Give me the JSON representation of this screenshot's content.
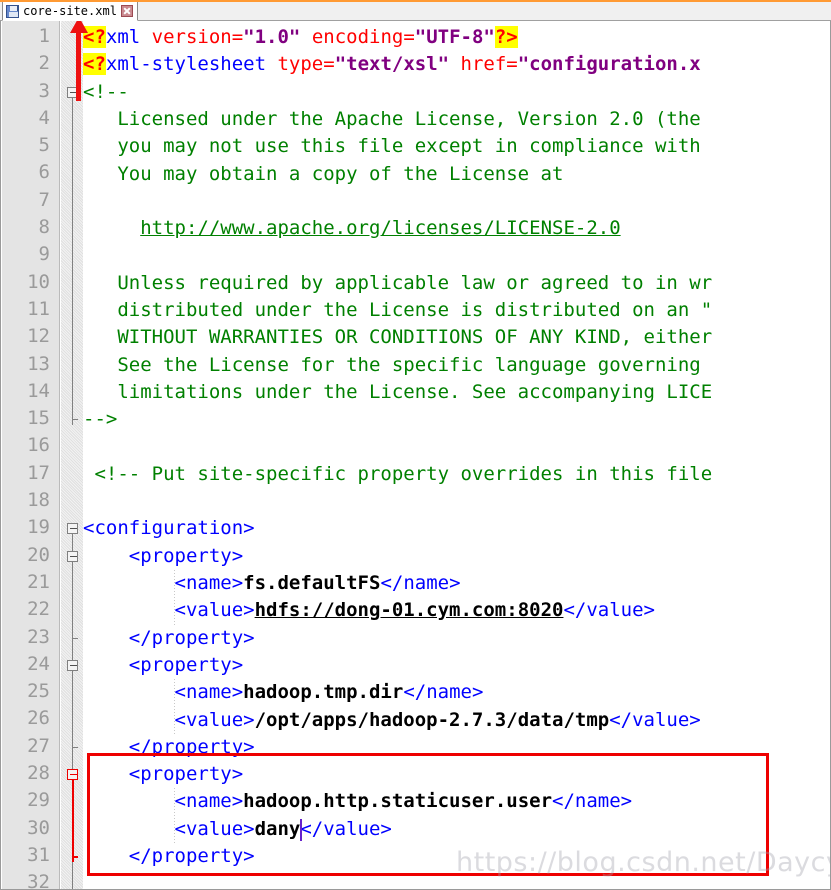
{
  "window": {
    "title": "core-site.xml",
    "accent_top_color": "#ff9a33"
  },
  "tab": {
    "label": "core-site.xml",
    "save_icon": "floppy-disk-icon",
    "close_icon": "close-icon"
  },
  "editor": {
    "language": "xml",
    "total_lines_visible": 32,
    "cursor": {
      "line": 30,
      "after_text": "dany"
    },
    "current_line": 30,
    "line_numbers": [
      "1",
      "2",
      "3",
      "4",
      "5",
      "6",
      "7",
      "8",
      "9",
      "10",
      "11",
      "12",
      "13",
      "14",
      "15",
      "16",
      "17",
      "18",
      "19",
      "20",
      "21",
      "22",
      "23",
      "24",
      "25",
      "26",
      "27",
      "28",
      "29",
      "30",
      "31",
      "32"
    ],
    "lines": [
      {
        "n": 1,
        "segments": [
          {
            "cls": "t-pi",
            "text": "<?"
          },
          {
            "cls": "t-tag",
            "text": "xml "
          },
          {
            "cls": "t-attr",
            "text": "version="
          },
          {
            "cls": "t-str",
            "text": "\"1.0\""
          },
          {
            "cls": "t-attr",
            "text": " encoding="
          },
          {
            "cls": "t-str",
            "text": "\"UTF-8\""
          },
          {
            "cls": "t-pi",
            "text": "?>"
          }
        ]
      },
      {
        "n": 2,
        "segments": [
          {
            "cls": "t-pi",
            "text": "<?"
          },
          {
            "cls": "t-tag",
            "text": "xml-stylesheet "
          },
          {
            "cls": "t-attr",
            "text": "type="
          },
          {
            "cls": "t-str",
            "text": "\"text/xsl\""
          },
          {
            "cls": "t-attr",
            "text": " href="
          },
          {
            "cls": "t-str",
            "text": "\"configuration.x"
          }
        ]
      },
      {
        "n": 3,
        "segments": [
          {
            "cls": "t-comment",
            "text": "<!--"
          }
        ]
      },
      {
        "n": 4,
        "segments": [
          {
            "cls": "t-comment",
            "text": "   Licensed under the Apache License, Version 2.0 (the"
          }
        ]
      },
      {
        "n": 5,
        "segments": [
          {
            "cls": "t-comment",
            "text": "   you may not use this file except in compliance with"
          }
        ]
      },
      {
        "n": 6,
        "segments": [
          {
            "cls": "t-comment",
            "text": "   You may obtain a copy of the License at"
          }
        ]
      },
      {
        "n": 7,
        "segments": [
          {
            "cls": "t-comment",
            "text": ""
          }
        ]
      },
      {
        "n": 8,
        "segments": [
          {
            "cls": "t-comment",
            "text": "     "
          },
          {
            "cls": "t-url",
            "text": "http://www.apache.org/licenses/LICENSE-2.0"
          }
        ]
      },
      {
        "n": 9,
        "segments": [
          {
            "cls": "t-comment",
            "text": ""
          }
        ]
      },
      {
        "n": 10,
        "segments": [
          {
            "cls": "t-comment",
            "text": "   Unless required by applicable law or agreed to in wr"
          }
        ]
      },
      {
        "n": 11,
        "segments": [
          {
            "cls": "t-comment",
            "text": "   distributed under the License is distributed on an \""
          }
        ]
      },
      {
        "n": 12,
        "segments": [
          {
            "cls": "t-comment",
            "text": "   WITHOUT WARRANTIES OR CONDITIONS OF ANY KIND, either"
          }
        ]
      },
      {
        "n": 13,
        "segments": [
          {
            "cls": "t-comment",
            "text": "   See the License for the specific language governing "
          }
        ]
      },
      {
        "n": 14,
        "segments": [
          {
            "cls": "t-comment",
            "text": "   limitations under the License. See accompanying LICE"
          }
        ]
      },
      {
        "n": 15,
        "segments": [
          {
            "cls": "t-comment",
            "text": "-->"
          }
        ]
      },
      {
        "n": 16,
        "segments": [
          {
            "cls": "t-comment",
            "text": ""
          }
        ]
      },
      {
        "n": 17,
        "segments": [
          {
            "cls": "t-comment",
            "text": " <!-- Put site-specific property overrides in this file"
          }
        ]
      },
      {
        "n": 18,
        "segments": [
          {
            "cls": "t-comment",
            "text": ""
          }
        ]
      },
      {
        "n": 19,
        "segments": [
          {
            "cls": "t-tag",
            "text": "<configuration>"
          }
        ]
      },
      {
        "n": 20,
        "segments": [
          {
            "cls": "t-tag",
            "text": "    <property>"
          }
        ]
      },
      {
        "n": 21,
        "segments": [
          {
            "cls": "t-tag",
            "text": "        <name>"
          },
          {
            "cls": "t-text",
            "text": "fs.defaultFS"
          },
          {
            "cls": "t-tag",
            "text": "</name>"
          }
        ]
      },
      {
        "n": 22,
        "segments": [
          {
            "cls": "t-tag",
            "text": "        <value>"
          },
          {
            "cls": "t-urlblk",
            "text": "hdfs://dong-01.cym.com:8020"
          },
          {
            "cls": "t-tag",
            "text": "</value>"
          }
        ]
      },
      {
        "n": 23,
        "segments": [
          {
            "cls": "t-tag",
            "text": "    </property>"
          }
        ]
      },
      {
        "n": 24,
        "segments": [
          {
            "cls": "t-tag",
            "text": "    <property>"
          }
        ]
      },
      {
        "n": 25,
        "segments": [
          {
            "cls": "t-tag",
            "text": "        <name>"
          },
          {
            "cls": "t-text",
            "text": "hadoop.tmp.dir"
          },
          {
            "cls": "t-tag",
            "text": "</name>"
          }
        ]
      },
      {
        "n": 26,
        "segments": [
          {
            "cls": "t-tag",
            "text": "        <value>"
          },
          {
            "cls": "t-text",
            "text": "/opt/apps/hadoop-2.7.3/data/tmp"
          },
          {
            "cls": "t-tag",
            "text": "</value>"
          }
        ]
      },
      {
        "n": 27,
        "segments": [
          {
            "cls": "t-tag",
            "text": "    </property>"
          }
        ]
      },
      {
        "n": 28,
        "segments": [
          {
            "cls": "t-tag",
            "text": "    <property>"
          }
        ]
      },
      {
        "n": 29,
        "segments": [
          {
            "cls": "t-tag",
            "text": "        <name>"
          },
          {
            "cls": "t-text",
            "text": "hadoop.http.staticuser.user"
          },
          {
            "cls": "t-tag",
            "text": "</name>"
          }
        ]
      },
      {
        "n": 30,
        "segments": [
          {
            "cls": "t-tag",
            "text": "        <value>"
          },
          {
            "cls": "t-text",
            "text": "dany"
          },
          {
            "cls": "t-tag",
            "text": "</value>"
          }
        ]
      },
      {
        "n": 31,
        "segments": [
          {
            "cls": "t-tag",
            "text": "    </property>"
          }
        ]
      },
      {
        "n": 32,
        "segments": [
          {
            "cls": "t-tag",
            "text": ""
          }
        ]
      }
    ]
  },
  "annotations": {
    "red_arrow": {
      "points_to_line": 1,
      "from_line": 3,
      "color": "#ee1111"
    },
    "red_box": {
      "covers_lines": [
        28,
        31
      ],
      "color": "#ee0000"
    }
  },
  "watermark": {
    "text": "https://blog.csdn.net/Daycym"
  },
  "colors": {
    "tag": "#0000ff",
    "attribute": "#ff0000",
    "string": "#800080",
    "comment": "#008000",
    "text_content": "#000000",
    "processing_instruction_highlight": "#ffff00",
    "current_line_highlight": "#e6e6fa",
    "gutter_background": "#e4e4e4",
    "line_number": "#9a9a9a",
    "editor_background": "#ffffff"
  }
}
